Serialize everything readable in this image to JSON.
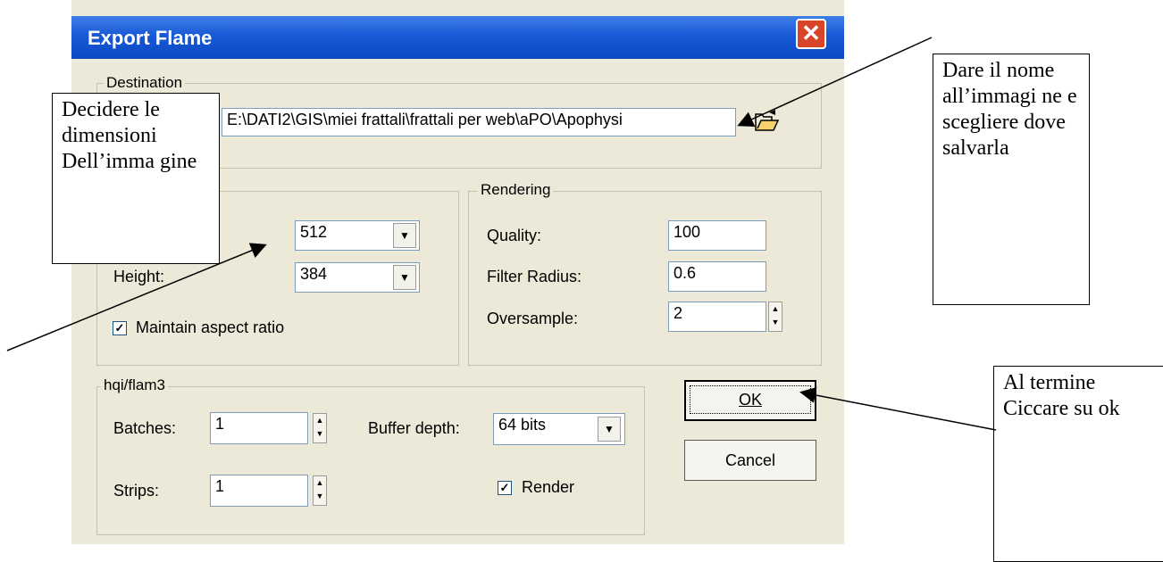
{
  "dialog": {
    "title": "Export Flame",
    "close_symbol": "✕"
  },
  "destination": {
    "legend": "Destination",
    "path": "E:\\DATI2\\GIS\\miei frattali\\frattali per web\\aPO\\Apophysi",
    "browse_icon": "folder-open-icon"
  },
  "size": {
    "width_value": "512",
    "height_label": "Height:",
    "height_value": "384",
    "maintain_label": "Maintain aspect ratio",
    "maintain_checked": true
  },
  "rendering": {
    "legend": "Rendering",
    "quality_label": "Quality:",
    "quality_value": "100",
    "filter_label": "Filter Radius:",
    "filter_value": "0.6",
    "oversample_label": "Oversample:",
    "oversample_value": "2"
  },
  "hqi": {
    "legend": "hqi/flam3",
    "batches_label": "Batches:",
    "batches_value": "1",
    "strips_label": "Strips:",
    "strips_value": "1",
    "buffer_label": "Buffer depth:",
    "buffer_value": "64 bits",
    "render_label": "Render",
    "render_checked": true
  },
  "buttons": {
    "ok": "OK",
    "cancel": "Cancel"
  },
  "callouts": {
    "dimensions": "Decidere le dimensioni Dell’imma gine",
    "name": "Dare il nome all’immagi ne e scegliere dove salvarla",
    "ok": "Al termine Ciccare su ok"
  },
  "colors": {
    "titlebar": "#0a49c2",
    "dialog_bg": "#ece9d8",
    "close": "#d8452b"
  }
}
